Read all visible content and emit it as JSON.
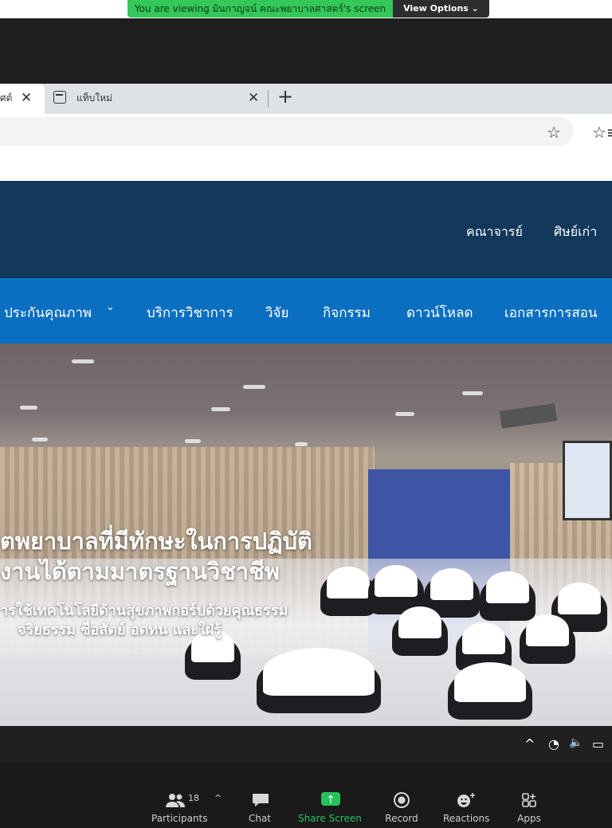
{
  "zoom": {
    "banner_text": "You are viewing มินกาญจน์ คณะพยาบาลศาสตร์'s screen",
    "view_options_label": "View Options ⌄"
  },
  "browser": {
    "active_tab_title": "ศต์",
    "new_tab_title": "แท็บใหม่",
    "close_glyph": "✕",
    "new_tab_glyph": "+",
    "star_add_glyph": "☆",
    "favorites_glyph": "☆≡"
  },
  "site": {
    "top_nav": [
      "คณาจารย์",
      "ศิษย์เก่า"
    ],
    "main_nav": {
      "qa": "ประกันคุณภาพ",
      "service": "บริการวิชาการ",
      "research": "วิจัย",
      "activity": "กิจกรรม",
      "download": "ดาวน์โหลด",
      "docs": "เอกสารการสอน"
    },
    "chevron": "⌄",
    "hero": {
      "title_line1": "ิตพยาบาลที่มีทักษะในการปฏิบัติ",
      "title_line2": "งานได้ตามมาตรฐานวิชาชีพ",
      "subtitle_line1": "ารใช้เทคโนโลยีด้านสุขภาพกอร์ปด้วยคุณธรรม",
      "subtitle_line2": "จริยธรรม ซื่อสัตย์ อดทน และใฝ่รู้"
    }
  },
  "taskbar": {
    "chevron_up": "^",
    "wifi": "◔",
    "volume": "🔈",
    "battery": "▭"
  },
  "toolbar": {
    "participants_label": "Participants",
    "participants_count": "18",
    "participants_caret": "^",
    "chat_label": "Chat",
    "share_label": "Share Screen",
    "record_label": "Record",
    "reactions_label": "Reactions",
    "apps_label": "Apps"
  }
}
